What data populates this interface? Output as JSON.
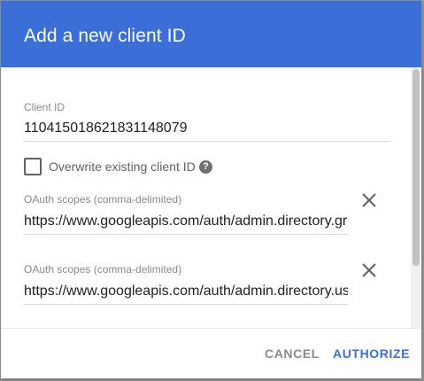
{
  "dialog": {
    "title": "Add a new client ID"
  },
  "client_id": {
    "label": "Client ID",
    "value": "110415018621831148079"
  },
  "overwrite": {
    "label": "Overwrite existing client ID",
    "checked": false,
    "help_icon": "?"
  },
  "scopes": [
    {
      "label": "OAuth scopes (comma-delimited)",
      "value": "https://www.googleapis.com/auth/admin.directory.group"
    },
    {
      "label": "OAuth scopes (comma-delimited)",
      "value": "https://www.googleapis.com/auth/admin.directory.user"
    }
  ],
  "actions": {
    "cancel": "CANCEL",
    "authorize": "AUTHORIZE"
  },
  "colors": {
    "header": "#3b6fd8",
    "primary_button": "#3b6fd8"
  }
}
